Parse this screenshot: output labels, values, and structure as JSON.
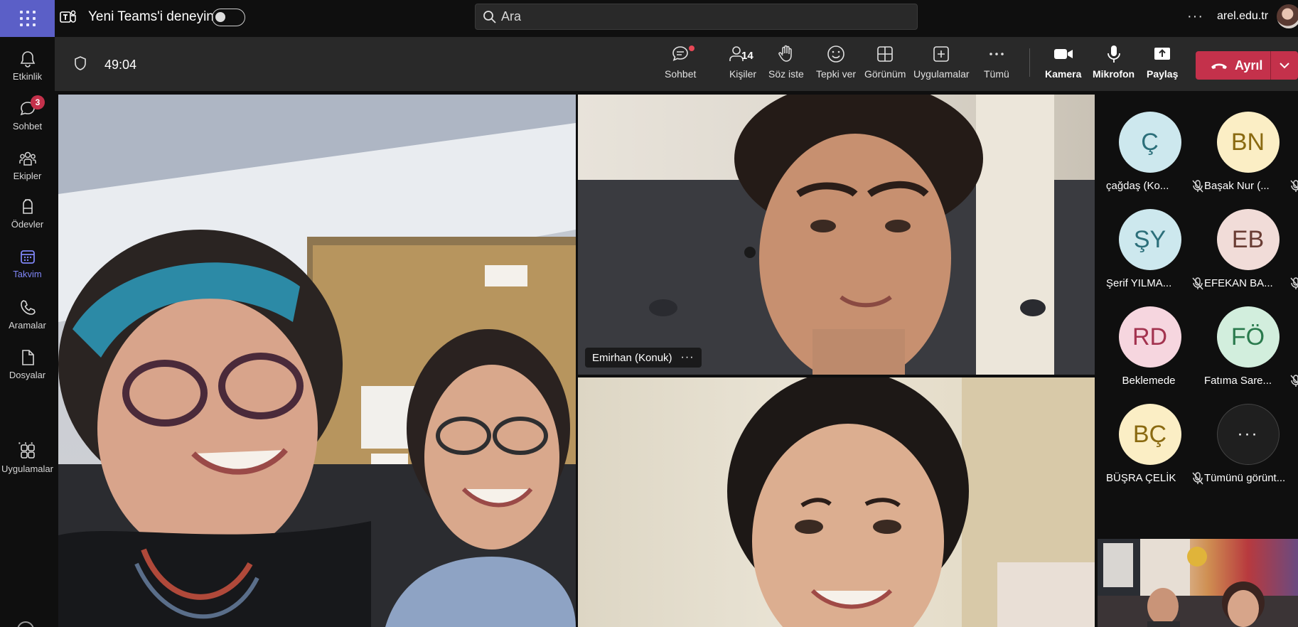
{
  "topbar": {
    "try_teams_label": "Yeni Teams'i deneyin",
    "search_placeholder": "Ara",
    "more_label": "···",
    "org": "arel.edu.tr"
  },
  "rail": {
    "items": [
      {
        "label": "Etkinlik",
        "icon": "bell-icon"
      },
      {
        "label": "Sohbet",
        "icon": "chat-icon",
        "badge": "3"
      },
      {
        "label": "Ekipler",
        "icon": "teams-icon"
      },
      {
        "label": "Ödevler",
        "icon": "backpack-icon"
      },
      {
        "label": "Takvim",
        "icon": "calendar-icon",
        "active": true
      },
      {
        "label": "Aramalar",
        "icon": "phone-icon"
      },
      {
        "label": "Dosyalar",
        "icon": "file-icon"
      },
      {
        "label": "Uygulamalar",
        "icon": "apps-icon"
      }
    ],
    "more_label": "···"
  },
  "meeting": {
    "timer": "49:04",
    "toolbar": {
      "chat": "Sohbet",
      "people": "Kişiler",
      "people_count": "14",
      "raise_hand": "Söz iste",
      "react": "Tepki ver",
      "view": "Görünüm",
      "apps": "Uygulamalar",
      "more": "Tümü",
      "camera": "Kamera",
      "mic": "Mikrofon",
      "share": "Paylaş",
      "leave": "Ayrıl"
    },
    "tiles": {
      "b_name": "Emirhan (Konuk)",
      "more_dots": "···"
    },
    "participants": [
      {
        "initials": "Ç",
        "name": "çağdaş (Ko...",
        "bg": "#cde8ee",
        "fg": "#2c6f7a",
        "muted": true
      },
      {
        "initials": "BN",
        "name": "Başak Nur (...",
        "bg": "#fbeec5",
        "fg": "#8a6a11",
        "muted": true
      },
      {
        "initials": "ŞY",
        "name": "Şerif YILMA...",
        "bg": "#cde8ee",
        "fg": "#2c6f7a",
        "muted": true
      },
      {
        "initials": "EB",
        "name": "EFEKAN BA...",
        "bg": "#f1dcd8",
        "fg": "#6a3d34",
        "muted": true
      },
      {
        "initials": "RD",
        "name": "Beklemede",
        "bg": "#f6d6df",
        "fg": "#a3334f",
        "muted": false
      },
      {
        "initials": "FÖ",
        "name": "Fatıma Sare...",
        "bg": "#d2eedd",
        "fg": "#2a7a4d",
        "muted": true
      },
      {
        "initials": "BÇ",
        "name": "BÜŞRA ÇELİK",
        "bg": "#fbeec5",
        "fg": "#8a6a11",
        "muted": true
      }
    ],
    "view_all": {
      "label": "Tümünü görünt...",
      "dots": "···"
    }
  },
  "colors": {
    "accent": "#5b5fc7",
    "active_rail": "#7f85f5",
    "leave_red": "#c4314b",
    "toolbar_bg": "#292929",
    "app_bg": "#0f0f0f"
  }
}
